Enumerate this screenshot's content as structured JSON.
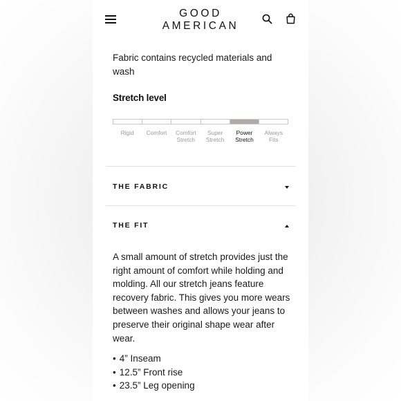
{
  "header": {
    "brand_line1": "GOOD",
    "brand_line2": "AMERICAN",
    "icons": [
      "menu-icon",
      "search-icon",
      "bag-icon"
    ]
  },
  "product": {
    "fabric_note": "Fabric contains recycled materials and wash",
    "stretch": {
      "title": "Stretch level",
      "levels": [
        "Rigid",
        "Comfort",
        "Comfort\nStretch",
        "Super\nStretch",
        "Power\nStretch",
        "Always\nFits"
      ],
      "selected_index": 4,
      "selected_label": "Power Stretch",
      "active_color": "#b3aaa6"
    }
  },
  "accordion": {
    "fabric": {
      "title": "THE FABRIC",
      "expanded": false
    },
    "fit": {
      "title": "THE FIT",
      "expanded": true,
      "body": "A small amount of stretch provides just the right amount of comfort while holding and molding. All our stretch jeans feature recovery fabric. This gives you more wears between washes and allows your jeans to preserve their original shape wear after wear.",
      "bullets": [
        "4” Inseam",
        "12.5” Front rise",
        "23.5” Leg opening"
      ]
    }
  }
}
